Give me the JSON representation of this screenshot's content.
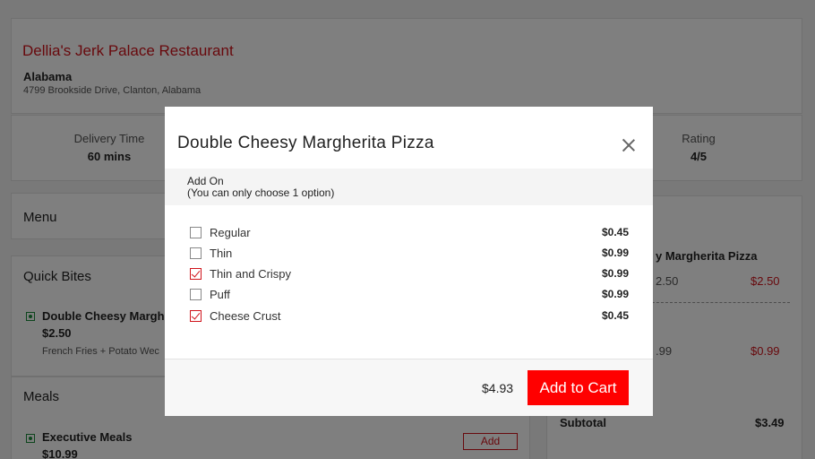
{
  "restaurant": {
    "name": "Dellia's Jerk Palace Restaurant",
    "state": "Alabama",
    "address": "4799 Brookside Drive, Clanton, Alabama"
  },
  "stats": {
    "delivery_label": "Delivery Time",
    "delivery_value": "60 mins",
    "rating_label": "Rating",
    "rating_value": "4/5"
  },
  "menu": {
    "title": "Menu",
    "sections": [
      {
        "title": "Quick Bites",
        "items": [
          {
            "name": "Double Cheesy Marghe",
            "price": "$2.50",
            "desc": "French Fries + Potato Wec"
          }
        ]
      },
      {
        "title": "Meals",
        "items": [
          {
            "name": "Executive Meals",
            "price": "$10.99",
            "button": "Add"
          }
        ]
      }
    ]
  },
  "cart": {
    "items": [
      {
        "name": "y Margherita Pizza",
        "qty": "2.50",
        "price": "$2.50"
      },
      {
        "qty": ".99",
        "price": "$0.99"
      }
    ],
    "subtotal_label": "Subtotal",
    "subtotal_value": "$3.49"
  },
  "modal": {
    "title": "Double Cheesy Margherita Pizza",
    "addon_title": "Add On",
    "addon_note": "(You can only choose 1 option)",
    "options": [
      {
        "label": "Regular",
        "price": "$0.45",
        "checked": false
      },
      {
        "label": "Thin",
        "price": "$0.99",
        "checked": false
      },
      {
        "label": "Thin and Crispy",
        "price": "$0.99",
        "checked": true
      },
      {
        "label": "Puff",
        "price": "$0.99",
        "checked": false
      },
      {
        "label": "Cheese Crust",
        "price": "$0.45",
        "checked": true
      }
    ],
    "total": "$4.93",
    "add_to_cart": "Add to Cart"
  },
  "colors": {
    "brand_red": "#d0131b",
    "button_red": "#ff0000"
  },
  "icons": {
    "close": "close-icon",
    "checkbox_checked": "checkmark-icon",
    "veg": "veg-indicator-icon"
  }
}
